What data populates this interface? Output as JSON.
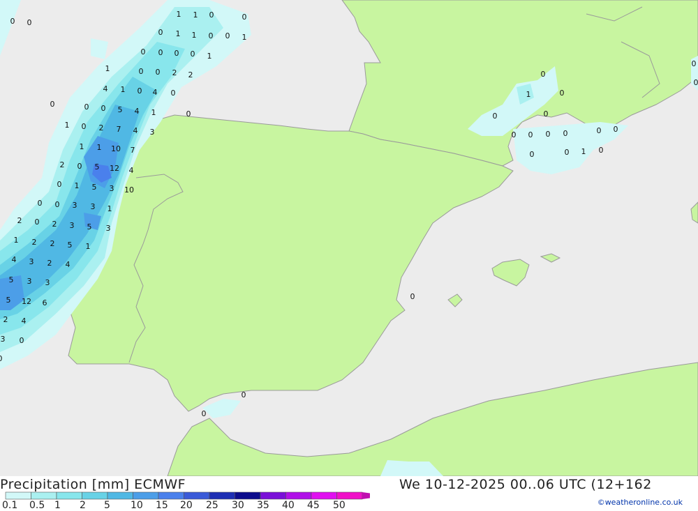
{
  "title": "Precipitation [mm] ECMWF",
  "datetime": "We 10-12-2025 00..06 UTC (12+162",
  "credit": "©weatheronline.co.uk",
  "legend": {
    "ticks": [
      "0.1",
      "0.5",
      "1",
      "2",
      "5",
      "10",
      "15",
      "20",
      "25",
      "30",
      "35",
      "40",
      "45",
      "50"
    ],
    "colors": [
      "#d2f8f8",
      "#aaf0f0",
      "#88e6ec",
      "#68d2e6",
      "#50b8e4",
      "#4c9ee8",
      "#4a80ec",
      "#3a5ad8",
      "#1e2fb4",
      "#0c0c8c",
      "#7a10d8",
      "#b010e8",
      "#e010f0",
      "#f010c8",
      "#c010b0"
    ]
  },
  "colors": {
    "sea": "#ececec",
    "land": "#c8f5a0",
    "border": "#9a9a9a"
  },
  "values": [
    "0",
    "0",
    "1",
    "1",
    "0",
    "0",
    "0",
    "1",
    "1",
    "0",
    "0",
    "1",
    "0",
    "0",
    "0",
    "0",
    "1",
    "1",
    "0",
    "0",
    "2",
    "2",
    "1",
    "0",
    "4",
    "4",
    "0",
    "0",
    "0",
    "0",
    "5",
    "4",
    "1",
    "0",
    "1",
    "0",
    "2",
    "7",
    "4",
    "3",
    "1",
    "1",
    "10",
    "7",
    "2",
    "0",
    "5",
    "12",
    "4",
    "0",
    "1",
    "5",
    "3",
    "10",
    "0",
    "0",
    "3",
    "3",
    "1",
    "2",
    "0",
    "2",
    "3",
    "5",
    "3",
    "1",
    "2",
    "2",
    "5",
    "1",
    "4",
    "3",
    "2",
    "4",
    "5",
    "3",
    "3",
    "5",
    "12",
    "6",
    "2",
    "4",
    "3",
    "0",
    "0",
    "0",
    "1",
    "0",
    "0",
    "0",
    "0",
    "0",
    "0",
    "0",
    "0",
    "0",
    "0",
    "0",
    "1",
    "0",
    "0",
    "0",
    "0",
    "0",
    "0",
    "0"
  ]
}
